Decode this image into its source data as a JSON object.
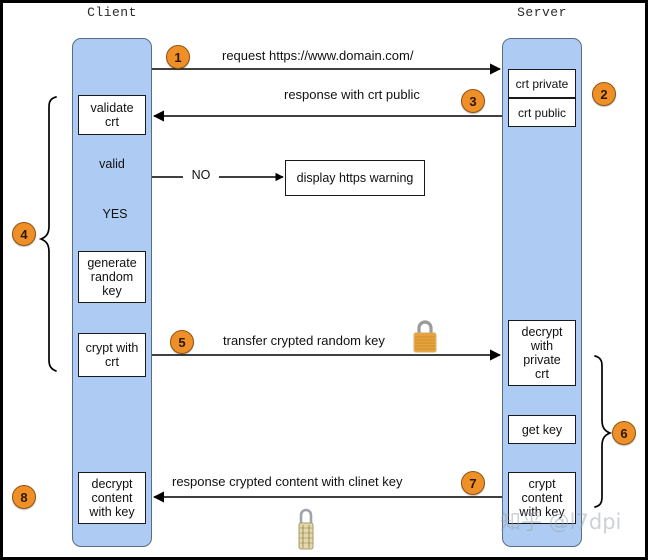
{
  "diagram": {
    "title_client": "Client",
    "title_server": "Server",
    "watermark": "知乎 @l7dpi"
  },
  "lifelines": [
    {
      "name": "client",
      "label": "Client"
    },
    {
      "name": "server",
      "label": "Server"
    }
  ],
  "client_boxes": [
    {
      "id": "validate-crt",
      "text": "validate\ncrt"
    },
    {
      "id": "generate-random-key",
      "text": "generate\nrandom\nkey"
    },
    {
      "id": "crypt-with-crt",
      "text": "crypt with\ncrt"
    },
    {
      "id": "decrypt-content-with-key",
      "text": "decrypt\ncontent\nwith key"
    }
  ],
  "client_decision": {
    "id": "valid",
    "text": "valid",
    "yes_label": "YES",
    "no_label": "NO"
  },
  "warning_box": {
    "id": "display-https-warning",
    "text": "display https warning"
  },
  "server_boxes": [
    {
      "id": "crt-private",
      "text": "crt private"
    },
    {
      "id": "crt-public",
      "text": "crt public"
    },
    {
      "id": "decrypt-with-private-crt",
      "text": "decrypt\nwith\nprivate\ncrt"
    },
    {
      "id": "get-key",
      "text": "get key"
    },
    {
      "id": "crypt-content-with-key",
      "text": "crypt\ncontent\nwith key"
    }
  ],
  "messages": [
    {
      "id": "request",
      "text": "request https://www.domain.com/",
      "direction": "client-to-server",
      "step": "1"
    },
    {
      "id": "response-crt-public",
      "text": "response with crt public",
      "direction": "server-to-client",
      "step": "3"
    },
    {
      "id": "transfer-crypted-random-key",
      "text": "transfer crypted random key",
      "direction": "client-to-server",
      "step": "5"
    },
    {
      "id": "response-crypted-content",
      "text": "response crypted content with clinet key",
      "direction": "server-to-client",
      "step": "7"
    }
  ],
  "steps": [
    {
      "number": "1"
    },
    {
      "number": "2"
    },
    {
      "number": "3"
    },
    {
      "number": "4"
    },
    {
      "number": "5"
    },
    {
      "number": "6"
    },
    {
      "number": "7"
    },
    {
      "number": "8"
    }
  ],
  "icons": [
    {
      "id": "padlock-closed",
      "name": "padlock-icon"
    },
    {
      "id": "combination-padlock",
      "name": "combination-padlock-icon"
    }
  ],
  "colors": {
    "lifeline_fill": "#aeccf3",
    "lifeline_stroke": "#5b6a87",
    "step_fill": "#ef8f28",
    "step_stroke": "#8f5411",
    "box_fill": "#ffffff",
    "line": "#000000"
  }
}
